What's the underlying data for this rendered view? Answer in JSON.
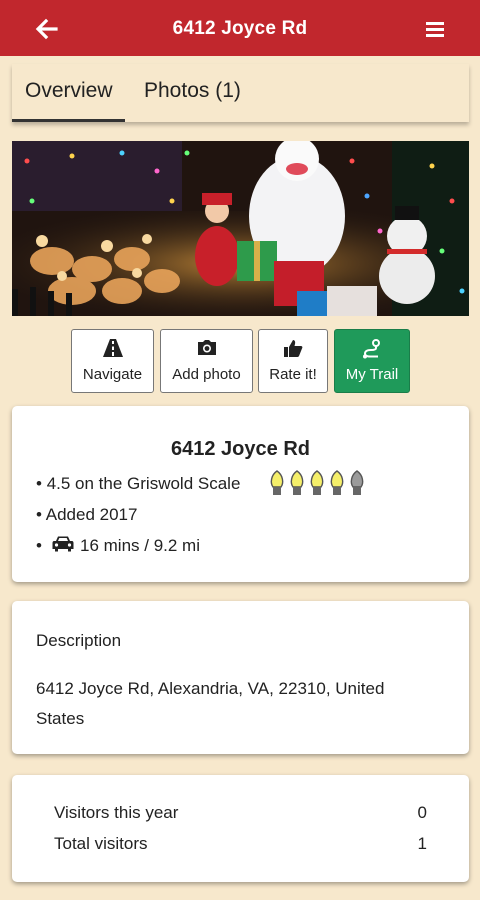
{
  "header": {
    "title": "6412 Joyce Rd",
    "back_icon": "arrow-left-icon",
    "menu_icon": "hamburger-menu-icon",
    "bar_color": "#c1272d"
  },
  "tabs": [
    {
      "label": "Overview",
      "active": true
    },
    {
      "label": "Photos (1)",
      "active": false
    }
  ],
  "actions": [
    {
      "label": "Navigate",
      "icon": "road-icon"
    },
    {
      "label": "Add photo",
      "icon": "camera-icon"
    },
    {
      "label": "Rate it!",
      "icon": "thumbs-up-icon"
    },
    {
      "label": "My Trail",
      "icon": "trail-icon",
      "color": "#1f9a5a"
    }
  ],
  "summary": {
    "title": "6412 Joyce Rd",
    "bullet": "•",
    "scale_text": "4.5 on the Griswold Scale",
    "rating": 4.5,
    "rating_max": 5,
    "added_text": "Added 2017",
    "drive_text": "16 mins / 9.2 mi",
    "drive_icon": "car-icon"
  },
  "description": {
    "heading": "Description",
    "body": "6412 Joyce Rd, Alexandria, VA, 22310, United States"
  },
  "stats": [
    {
      "label": "Visitors this year",
      "value": "0"
    },
    {
      "label": "Total visitors",
      "value": "1"
    }
  ]
}
